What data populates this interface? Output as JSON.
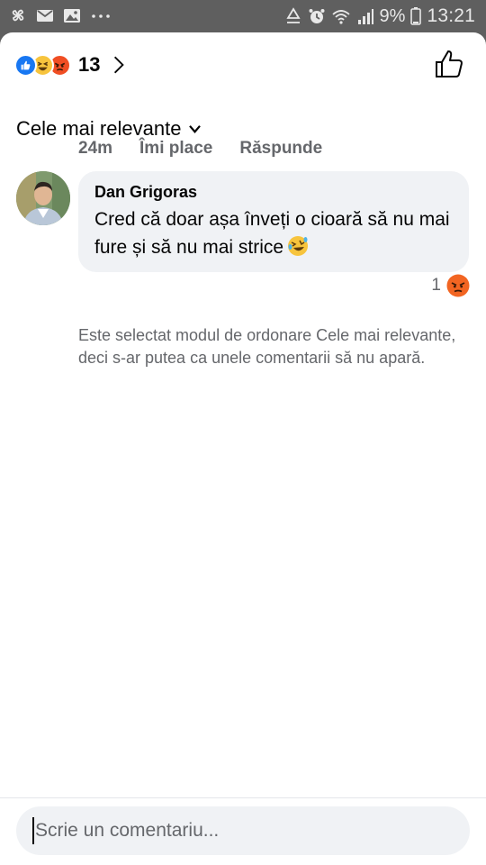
{
  "status_bar": {
    "battery_percent": "9%",
    "time": "13:21",
    "left_icons": [
      "pinwheel-icon",
      "mail-icon",
      "image-icon",
      "more-dots-icon"
    ],
    "right_icons": [
      "recycle-icon",
      "alarm-icon",
      "wifi-icon",
      "signal-icon",
      "battery-icon"
    ]
  },
  "reactions": {
    "types": [
      "like",
      "haha",
      "angry"
    ],
    "count": "13"
  },
  "sort": {
    "label": "Cele mai relevante"
  },
  "comment": {
    "author": "Dan Grigoras",
    "text": "Cred că doar așa înveți o cioară să nu mai fure și să nu mai strice",
    "time": "24m",
    "like_label": "Îmi place",
    "reply_label": "Răspunde",
    "reaction_count": "1",
    "reaction_type": "angry"
  },
  "notice": "Este selectat modul de ordonare Cele mai relevante, deci s-ar putea ca unele comentarii să nu apară.",
  "composer": {
    "placeholder": "Scrie un comentariu..."
  },
  "colors": {
    "accent_blue": "#1877f2",
    "angry": "#f04e23",
    "haha": "#f7c43d",
    "bubble_bg": "#f0f2f5",
    "secondary_text": "#65676b"
  }
}
